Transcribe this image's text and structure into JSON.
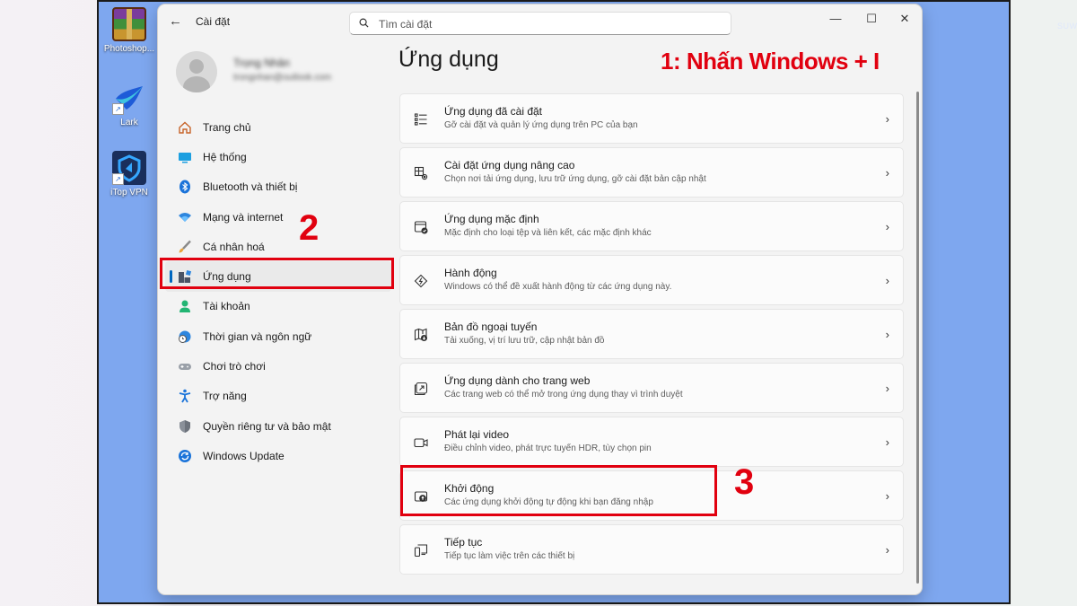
{
  "desktop": {
    "watermark": "SUWALLS",
    "icons": [
      {
        "label": "Photoshop...",
        "icon": "winrar-icon"
      },
      {
        "label": "Lark",
        "icon": "lark-icon"
      },
      {
        "label": "iTop VPN",
        "icon": "itop-vpn-icon"
      }
    ]
  },
  "window": {
    "title": "Cài đặt",
    "search_placeholder": "Tìm cài đặt",
    "controls": {
      "minimize": "—",
      "maximize": "☐",
      "close": "✕"
    }
  },
  "profile": {
    "name": "Trọng Nhân",
    "email": "trongnhan@outlook.com"
  },
  "sidebar": {
    "items": [
      {
        "label": "Trang chủ",
        "icon": "home-icon"
      },
      {
        "label": "Hệ thống",
        "icon": "system-icon"
      },
      {
        "label": "Bluetooth và thiết bị",
        "icon": "bluetooth-icon"
      },
      {
        "label": "Mạng và internet",
        "icon": "wifi-icon"
      },
      {
        "label": "Cá nhân hoá",
        "icon": "brush-icon"
      },
      {
        "label": "Ứng dụng",
        "icon": "apps-icon",
        "active": true
      },
      {
        "label": "Tài khoản",
        "icon": "account-icon"
      },
      {
        "label": "Thời gian và ngôn ngữ",
        "icon": "globe-clock-icon"
      },
      {
        "label": "Chơi trò chơi",
        "icon": "gamepad-icon"
      },
      {
        "label": "Trợ năng",
        "icon": "accessibility-icon"
      },
      {
        "label": "Quyền riêng tư và bảo mật",
        "icon": "shield-icon"
      },
      {
        "label": "Windows Update",
        "icon": "update-icon"
      }
    ]
  },
  "main": {
    "title": "Ứng dụng",
    "cards": [
      {
        "title": "Ứng dụng đã cài đặt",
        "subtitle": "Gỡ cài đặt và quản lý ứng dụng trên PC của bạn",
        "icon": "installed-apps-icon"
      },
      {
        "title": "Cài đặt ứng dụng nâng cao",
        "subtitle": "Chọn nơi tải ứng dụng, lưu trữ ứng dụng, gỡ cài đặt bản cập nhật",
        "icon": "advanced-apps-icon"
      },
      {
        "title": "Ứng dụng mặc định",
        "subtitle": "Mặc định cho loại tệp và liên kết, các mặc định khác",
        "icon": "default-apps-icon"
      },
      {
        "title": "Hành động",
        "subtitle": "Windows có thể đề xuất hành động từ các ứng dụng này.",
        "icon": "actions-icon"
      },
      {
        "title": "Bản đồ ngoại tuyến",
        "subtitle": "Tải xuống, vị trí lưu trữ, cập nhật bản đồ",
        "icon": "offline-maps-icon"
      },
      {
        "title": "Ứng dụng dành cho trang web",
        "subtitle": "Các trang web có thể mở trong ứng dụng thay vì trình duyệt",
        "icon": "web-apps-icon"
      },
      {
        "title": "Phát lại video",
        "subtitle": "Điều chỉnh video, phát trực tuyến HDR, tùy chọn pin",
        "icon": "video-icon"
      },
      {
        "title": "Khởi động",
        "subtitle": "Các ứng dụng khởi động tự động khi bạn đăng nhập",
        "icon": "startup-icon"
      },
      {
        "title": "Tiếp tục",
        "subtitle": "Tiếp tục làm việc trên các thiết bị",
        "icon": "resume-icon"
      }
    ]
  },
  "annotations": {
    "step1": "1: Nhấn Windows + I",
    "step2": "2",
    "step3": "3",
    "color": "#e1000f"
  }
}
